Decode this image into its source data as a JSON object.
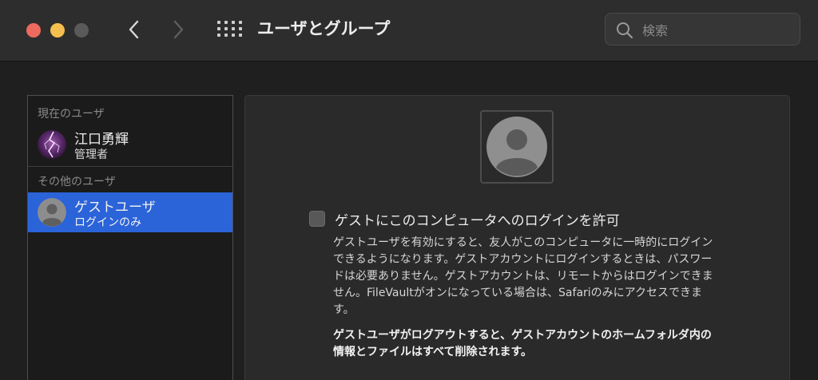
{
  "window": {
    "title": "ユーザとグループ"
  },
  "toolbar": {
    "back_icon": "chevron-left-icon",
    "forward_icon": "chevron-right-icon",
    "grid_icon": "show-all-grid-icon"
  },
  "search": {
    "placeholder": "検索",
    "value": ""
  },
  "sidebar": {
    "current_header": "現在のユーザ",
    "other_header": "その他のユーザ",
    "current_users": [
      {
        "name": "江口勇輝",
        "role": "管理者",
        "avatar": "lightning-photo-avatar"
      }
    ],
    "other_users": [
      {
        "name": "ゲストユーザ",
        "role": "ログインのみ",
        "avatar": "generic-user-avatar",
        "selected": true
      }
    ]
  },
  "main": {
    "guest_login_checkbox": {
      "label": "ゲストにこのコンピュータへのログインを許可",
      "checked": false
    },
    "description_lines": [
      "ゲストユーザを有効にすると、友人がこのコンピュータに一時的にログイン",
      "できるようになります。ゲストアカウントにログインするときは、パスワー",
      "ドは必要ありません。ゲストアカウントは、リモートからはログインできま",
      "せん。FileVaultがオンになっている場合は、Safariのみにアクセスできま",
      "す。"
    ],
    "warning_lines": [
      "ゲストユーザがログアウトすると、ゲストアカウントのホームフォルダ内の",
      "情報とファイルはすべて削除されます。"
    ]
  },
  "colors": {
    "selection": "#2b63d9",
    "close": "#ed6a5e",
    "minimize": "#f5bf4f"
  }
}
